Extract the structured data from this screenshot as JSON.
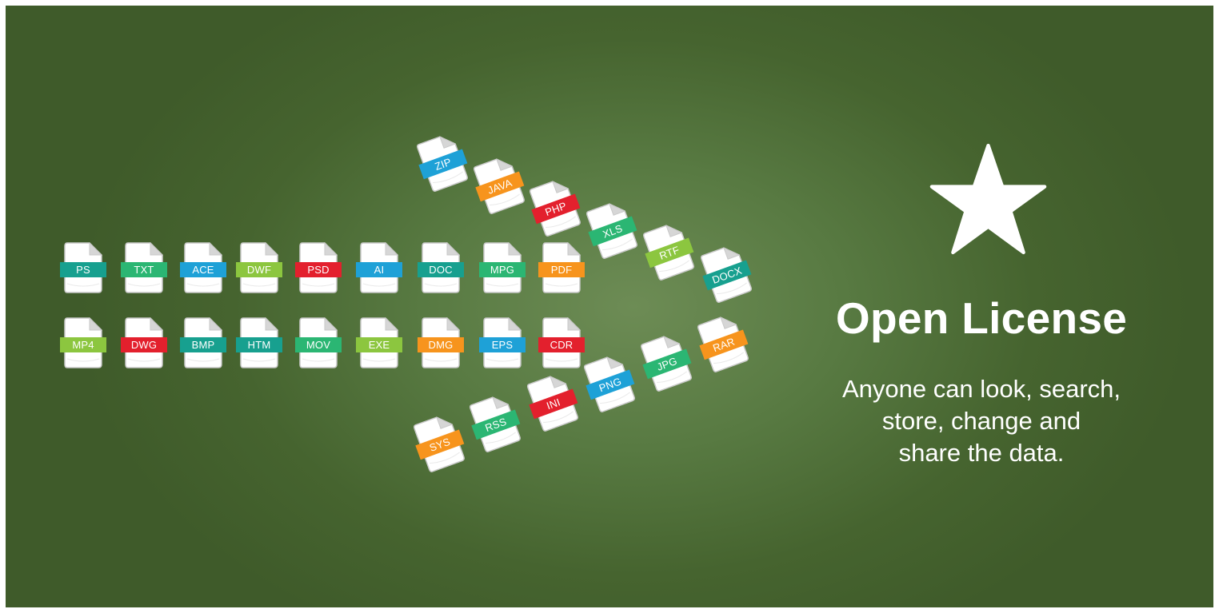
{
  "banner": {
    "title": "Open License",
    "subtitle_lines": [
      "Anyone can look, search,",
      "store, change and",
      "share the data."
    ],
    "icon": "star-icon",
    "colors": {
      "background": "#4a6a35",
      "text": "#ffffff",
      "file_body": "#ffffff"
    }
  },
  "files": [
    {
      "label": "PS",
      "color": "#17a08f"
    },
    {
      "label": "TXT",
      "color": "#2bb673"
    },
    {
      "label": "ACE",
      "color": "#1ea1d7"
    },
    {
      "label": "DWF",
      "color": "#8cc63f"
    },
    {
      "label": "PSD",
      "color": "#e3202d"
    },
    {
      "label": "AI",
      "color": "#1ea1d7"
    },
    {
      "label": "DOC",
      "color": "#17a08f"
    },
    {
      "label": "MPG",
      "color": "#2bb673"
    },
    {
      "label": "PDF",
      "color": "#f7941d"
    },
    {
      "label": "MP4",
      "color": "#8cc63f"
    },
    {
      "label": "DWG",
      "color": "#e3202d"
    },
    {
      "label": "BMP",
      "color": "#17a08f"
    },
    {
      "label": "HTM",
      "color": "#17a08f"
    },
    {
      "label": "MOV",
      "color": "#2bb673"
    },
    {
      "label": "EXE",
      "color": "#8cc63f"
    },
    {
      "label": "DMG",
      "color": "#f7941d"
    },
    {
      "label": "EPS",
      "color": "#1ea1d7"
    },
    {
      "label": "CDR",
      "color": "#e3202d"
    },
    {
      "label": "ZIP",
      "color": "#1ea1d7"
    },
    {
      "label": "JAVA",
      "color": "#f7941d"
    },
    {
      "label": "PHP",
      "color": "#e3202d"
    },
    {
      "label": "XLS",
      "color": "#2bb673"
    },
    {
      "label": "RTF",
      "color": "#8cc63f"
    },
    {
      "label": "DOCX",
      "color": "#17a08f"
    },
    {
      "label": "RAR",
      "color": "#f7941d"
    },
    {
      "label": "JPG",
      "color": "#2bb673"
    },
    {
      "label": "PNG",
      "color": "#1ea1d7"
    },
    {
      "label": "INI",
      "color": "#e3202d"
    },
    {
      "label": "RSS",
      "color": "#2bb673"
    },
    {
      "label": "SYS",
      "color": "#f7941d"
    }
  ]
}
